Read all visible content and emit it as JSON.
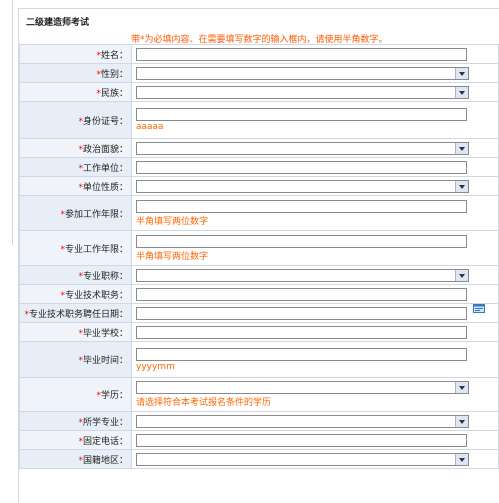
{
  "page": {
    "title": "二级建造师考试"
  },
  "notice": "带*为必填内容、在需要填写数字的输入框内，请使用半角数字。",
  "form": {
    "name": {
      "label": "姓名："
    },
    "gender": {
      "label": "性别："
    },
    "ethnicity": {
      "label": "民族："
    },
    "id_number": {
      "label": "身份证号：",
      "hint": "aaaaa"
    },
    "political": {
      "label": "政治面貌："
    },
    "employer": {
      "label": "工作单位："
    },
    "employer_type": {
      "label": "单位性质："
    },
    "work_years": {
      "label": "参加工作年限：",
      "hint": "半角填写两位数字"
    },
    "pro_years": {
      "label": "专业工作年限：",
      "hint": "半角填写两位数字"
    },
    "title": {
      "label": "专业职称："
    },
    "tech_post": {
      "label": "专业技术职务："
    },
    "tech_post_date": {
      "label": "专业技术职务聘任日期："
    },
    "school": {
      "label": "毕业学校："
    },
    "grad_time": {
      "label": "毕业时间：",
      "hint": "yyyymm"
    },
    "education": {
      "label": "学历：",
      "hint": "请选择符合本考试报名条件的学历"
    },
    "major": {
      "label": "所学专业："
    },
    "phone": {
      "label": "固定电话："
    },
    "region": {
      "label": "国籍地区："
    }
  },
  "icons": {
    "picker": "folder-picker-icon"
  },
  "colors": {
    "required": "#ff0000",
    "hint": "#ff6600",
    "label_bg": "#f0f4fa"
  }
}
